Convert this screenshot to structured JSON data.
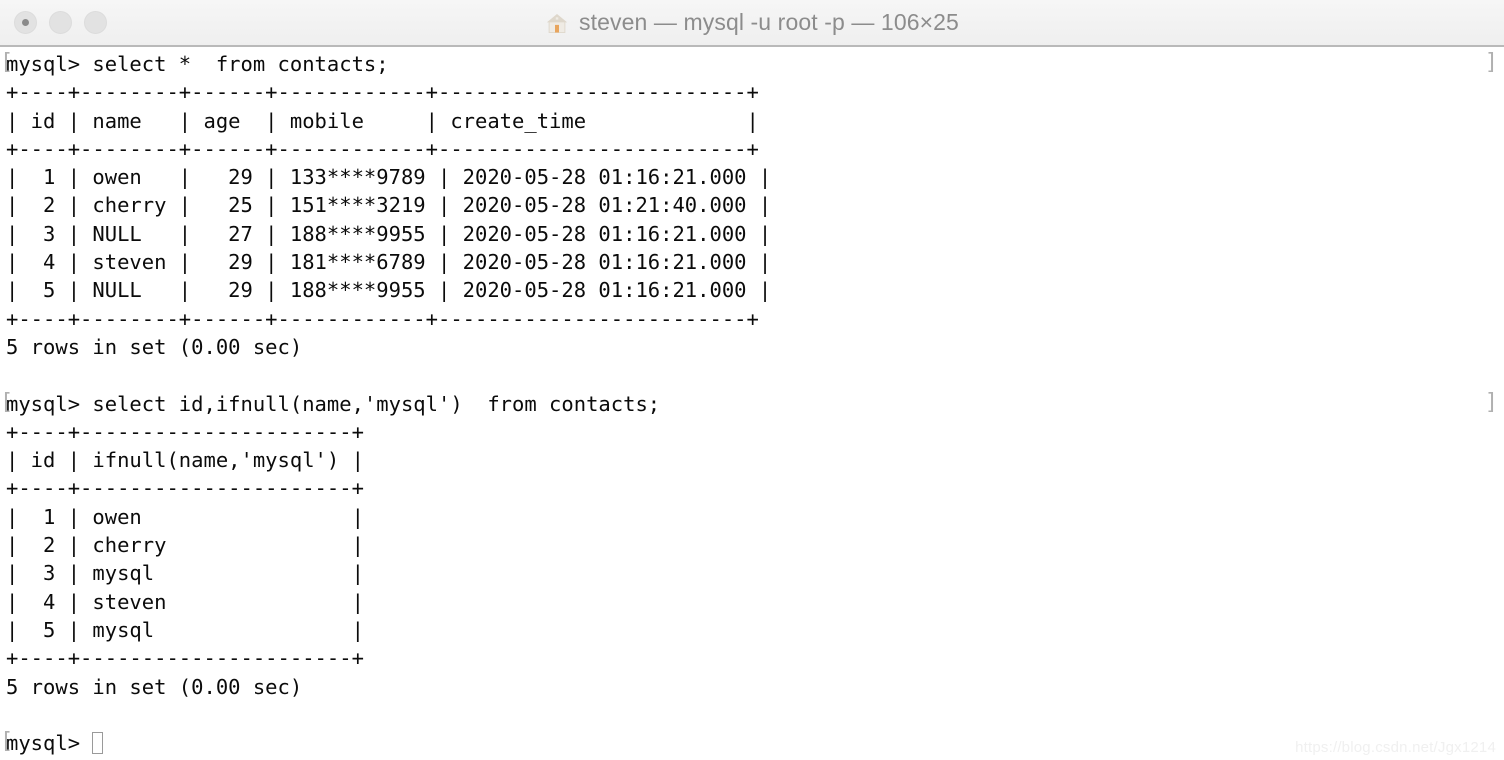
{
  "window": {
    "title": "steven — mysql -u root -p — 106×25",
    "icon": "house-icon",
    "traffic_lights": [
      {
        "name": "close",
        "label": "Close"
      },
      {
        "name": "minimize",
        "label": "Minimize"
      },
      {
        "name": "zoom",
        "label": "Zoom"
      }
    ],
    "colors": {
      "titlebar_bg": "#f2f2f2",
      "titlebar_border": "#b9b9b9",
      "terminal_bg": "#ffffff",
      "terminal_fg": "#0b0b0b",
      "prompt_mark": "#b0b0b0",
      "cursor": "#9a9a9a",
      "house_roof": "#e0d9cd",
      "house_door": "#e8a55e"
    }
  },
  "terminal": {
    "prompt": "mysql>",
    "prompt_mark_left": "[",
    "prompt_mark_right": "]",
    "commands": [
      "select *  from contacts;",
      "select id,ifnull(name,'mysql')  from contacts;"
    ],
    "lines": [
      {
        "kind": "prompt",
        "text": "mysql> select *  from contacts;"
      },
      {
        "kind": "output",
        "text": "+----+--------+------+------------+-------------------------+"
      },
      {
        "kind": "output",
        "text": "| id | name   | age  | mobile     | create_time             |"
      },
      {
        "kind": "output",
        "text": "+----+--------+------+------------+-------------------------+"
      },
      {
        "kind": "output",
        "text": "|  1 | owen   |   29 | 133****9789 | 2020-05-28 01:16:21.000 |"
      },
      {
        "kind": "output",
        "text": "|  2 | cherry |   25 | 151****3219 | 2020-05-28 01:21:40.000 |"
      },
      {
        "kind": "output",
        "text": "|  3 | NULL   |   27 | 188****9955 | 2020-05-28 01:16:21.000 |"
      },
      {
        "kind": "output",
        "text": "|  4 | steven |   29 | 181****6789 | 2020-05-28 01:16:21.000 |"
      },
      {
        "kind": "output",
        "text": "|  5 | NULL   |   29 | 188****9955 | 2020-05-28 01:16:21.000 |"
      },
      {
        "kind": "output",
        "text": "+----+--------+------+------------+-------------------------+"
      },
      {
        "kind": "output",
        "text": "5 rows in set (0.00 sec)"
      },
      {
        "kind": "blank",
        "text": ""
      },
      {
        "kind": "prompt",
        "text": "mysql> select id,ifnull(name,'mysql')  from contacts;"
      },
      {
        "kind": "output",
        "text": "+----+----------------------+"
      },
      {
        "kind": "output",
        "text": "| id | ifnull(name,'mysql') |"
      },
      {
        "kind": "output",
        "text": "+----+----------------------+"
      },
      {
        "kind": "output",
        "text": "|  1 | owen                 |"
      },
      {
        "kind": "output",
        "text": "|  2 | cherry               |"
      },
      {
        "kind": "output",
        "text": "|  3 | mysql                |"
      },
      {
        "kind": "output",
        "text": "|  4 | steven               |"
      },
      {
        "kind": "output",
        "text": "|  5 | mysql                |"
      },
      {
        "kind": "output",
        "text": "+----+----------------------+"
      },
      {
        "kind": "output",
        "text": "5 rows in set (0.00 sec)"
      },
      {
        "kind": "blank",
        "text": ""
      },
      {
        "kind": "cursor",
        "text": "mysql> "
      }
    ],
    "result_table_1": {
      "columns": [
        "id",
        "name",
        "age",
        "mobile",
        "create_time"
      ],
      "rows": [
        [
          "1",
          "owen",
          "29",
          "133****9789",
          "2020-05-28 01:16:21.000"
        ],
        [
          "2",
          "cherry",
          "25",
          "151****3219",
          "2020-05-28 01:21:40.000"
        ],
        [
          "3",
          "NULL",
          "27",
          "188****9955",
          "2020-05-28 01:16:21.000"
        ],
        [
          "4",
          "steven",
          "29",
          "181****6789",
          "2020-05-28 01:16:21.000"
        ],
        [
          "5",
          "NULL",
          "29",
          "188****9955",
          "2020-05-28 01:16:21.000"
        ]
      ],
      "footer": "5 rows in set (0.00 sec)"
    },
    "result_table_2": {
      "columns": [
        "id",
        "ifnull(name,'mysql')"
      ],
      "rows": [
        [
          "1",
          "owen"
        ],
        [
          "2",
          "cherry"
        ],
        [
          "3",
          "mysql"
        ],
        [
          "4",
          "steven"
        ],
        [
          "5",
          "mysql"
        ]
      ],
      "footer": "5 rows in set (0.00 sec)"
    }
  },
  "watermark": {
    "text": "https://blog.csdn.net/Jgx1214"
  }
}
